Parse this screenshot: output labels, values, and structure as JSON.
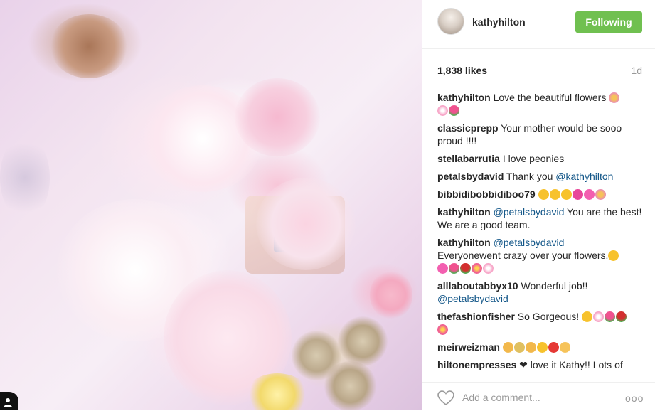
{
  "post": {
    "username": "kathyhilton",
    "follow_label": "Following",
    "likes": "1,838 likes",
    "age": "1d"
  },
  "colors": {
    "follow_button": "#70c050",
    "mention": "#125688"
  },
  "comments": [
    {
      "user": "kathyhilton",
      "text": "Love the beautiful flowers",
      "emoji": [
        "bouquet",
        "cherry-blossom",
        "tulip"
      ]
    },
    {
      "user": "classicprepp",
      "text": "Your mother would be sooo proud !!!!"
    },
    {
      "user": "stellabarrutia",
      "text": "I love peonies"
    },
    {
      "user": "petalsbydavid",
      "text": "Thank you",
      "mention": "@kathyhilton"
    },
    {
      "user": "bibbidibobbidiboo79",
      "emoji": [
        "heart-eyes",
        "kissing-face",
        "kissing-face",
        "heart",
        "sparkling-heart",
        "bouquet"
      ]
    },
    {
      "user": "kathyhilton",
      "mention": "@petalsbydavid",
      "text": "You are the best! We are a good team."
    },
    {
      "user": "kathyhilton",
      "mention": "@petalsbydavid",
      "text": "Everyonewent crazy over your flowers.",
      "emoji": [
        "smile",
        "sparkling-heart",
        "tulip",
        "rose",
        "hibiscus",
        "cherry-blossom"
      ]
    },
    {
      "user": "alllaboutabbyx10",
      "text": "Wonderful job!!",
      "mention": "@petalsbydavid"
    },
    {
      "user": "thefashionfisher",
      "text": "So Gorgeous!",
      "emoji": [
        "heart-eyes",
        "cherry-blossom",
        "tulip",
        "rose",
        "hibiscus"
      ]
    },
    {
      "user": "meirweizman",
      "emoji": [
        "party-popper",
        "confetti",
        "party-popper",
        "heart-eyes",
        "heart",
        "ok-hand"
      ]
    },
    {
      "user": "hiltonempresses",
      "emoji": [
        "black-heart"
      ],
      "text": "love it Kathy!! Lots of"
    }
  ],
  "footer": {
    "add_comment_placeholder": "Add a comment...",
    "more_label": "ooo"
  }
}
